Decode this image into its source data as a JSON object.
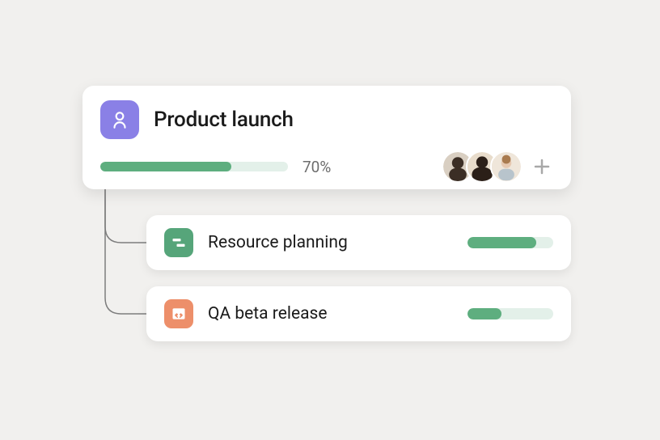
{
  "parent": {
    "title": "Product launch",
    "progress_percent": 70,
    "progress_label": "70%",
    "icon": "brain-icon",
    "accent": "#8a80e6",
    "members_count": 3
  },
  "children": [
    {
      "title": "Resource planning",
      "icon": "timeline-icon",
      "accent": "#56a57a",
      "progress_percent": 80
    },
    {
      "title": "QA beta release",
      "icon": "code-icon",
      "accent": "#ed8f6a",
      "progress_percent": 40
    }
  ],
  "colors": {
    "bar_fill": "#5eae7f",
    "bar_track": "#e3f0e9",
    "bg": "#f1f0ee"
  }
}
